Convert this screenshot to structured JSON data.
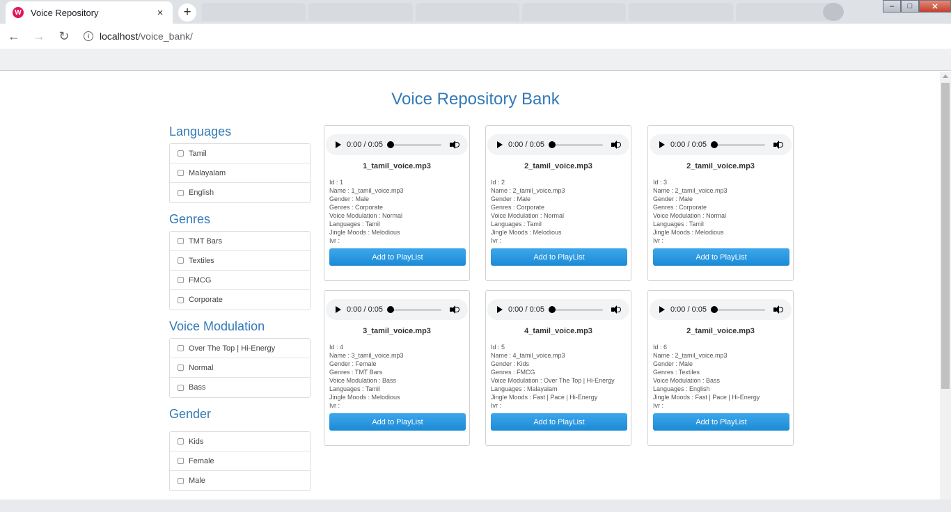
{
  "browser": {
    "tab_title": "Voice Repository",
    "tab_close": "×",
    "new_tab": "+",
    "url_host": "localhost",
    "url_path": "/voice_bank/"
  },
  "page": {
    "title": "Voice Repository Bank"
  },
  "filters": [
    {
      "heading": "Languages",
      "items": [
        "Tamil",
        "Malayalam",
        "English"
      ]
    },
    {
      "heading": "Genres",
      "items": [
        "TMT Bars",
        "Textiles",
        "FMCG",
        "Corporate"
      ]
    },
    {
      "heading": "Voice Modulation",
      "items": [
        "Over The Top | Hi-Energy",
        "Normal",
        "Bass"
      ]
    },
    {
      "heading": "Gender",
      "items": [
        "Kids",
        "Female",
        "Male"
      ]
    }
  ],
  "player": {
    "time": "0:00 / 0:05"
  },
  "add_button_label": "Add to PlayList",
  "cards": [
    {
      "file": "1_tamil_voice.mp3",
      "progress": 0.0,
      "meta": [
        "Id : 1",
        "Name : 1_tamil_voice.mp3",
        "Gender : Male",
        "Genres : Corporate",
        "Voice Modulation : Normal",
        "Languages : Tamil",
        "Jingle Moods : Melodious",
        "Ivr :"
      ]
    },
    {
      "file": "2_tamil_voice.mp3",
      "progress": 0.0,
      "meta": [
        "Id : 2",
        "Name : 2_tamil_voice.mp3",
        "Gender : Male",
        "Genres : Corporate",
        "Voice Modulation : Normal",
        "Languages : Tamil",
        "Jingle Moods : Melodious",
        "Ivr :"
      ]
    },
    {
      "file": "2_tamil_voice.mp3",
      "progress": 0.0,
      "meta": [
        "Id : 3",
        "Name : 2_tamil_voice.mp3",
        "Gender : Male",
        "Genres : Corporate",
        "Voice Modulation : Normal",
        "Languages : Tamil",
        "Jingle Moods : Melodious",
        "Ivr :"
      ]
    },
    {
      "file": "3_tamil_voice.mp3",
      "progress": 0.0,
      "meta": [
        "Id : 4",
        "Name : 3_tamil_voice.mp3",
        "Gender : Female",
        "Genres : TMT Bars",
        "Voice Modulation : Bass",
        "Languages : Tamil",
        "Jingle Moods : Melodious",
        "Ivr :"
      ]
    },
    {
      "file": "4_tamil_voice.mp3",
      "progress": 0.0,
      "meta": [
        "Id : 5",
        "Name : 4_tamil_voice.mp3",
        "Gender : Kids",
        "Genres : FMCG",
        "Voice Modulation : Over The Top | Hi-Energy",
        "Languages : Malayalam",
        "Jingle Moods : Fast | Pace | Hi-Energy",
        "Ivr :"
      ]
    },
    {
      "file": "2_tamil_voice.mp3",
      "progress": 0.0,
      "meta": [
        "Id : 6",
        "Name : 2_tamil_voice.mp3",
        "Gender : Male",
        "Genres : Textiles",
        "Voice Modulation : Bass",
        "Languages : English",
        "Jingle Moods : Fast | Pace | Hi-Energy",
        "Ivr :"
      ]
    }
  ]
}
